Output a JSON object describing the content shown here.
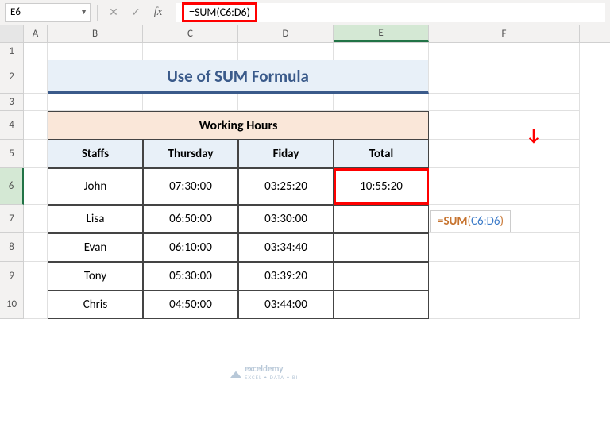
{
  "nameBox": "E6",
  "formula": "=SUM(C6:D6)",
  "columns": [
    "A",
    "B",
    "C",
    "D",
    "E",
    "F"
  ],
  "selectedCol": "E",
  "selectedRow": 6,
  "title": "Use of SUM Formula",
  "tableHeader": "Working Hours",
  "headers": {
    "staffs": "Staffs",
    "thursday": "Thursday",
    "friday": "Fiday",
    "total": "Total"
  },
  "rows": [
    {
      "staff": "John",
      "thu": "07:30:00",
      "fri": "03:25:20",
      "total": "10:55:20"
    },
    {
      "staff": "Lisa",
      "thu": "06:50:00",
      "fri": "03:30:00",
      "total": ""
    },
    {
      "staff": "Evan",
      "thu": "06:10:00",
      "fri": "03:34:40",
      "total": ""
    },
    {
      "staff": "Tony",
      "thu": "05:30:00",
      "fri": "03:39:20",
      "total": ""
    },
    {
      "staff": "Chris",
      "thu": "04:50:00",
      "fri": "03:44:00",
      "total": ""
    }
  ],
  "annotFormula": {
    "eq": "=",
    "fn": "SUM",
    "open": "(",
    "ref": "C6:D6",
    "close": ")"
  },
  "watermark": {
    "brand": "exceldemy",
    "tagline": "EXCEL • DATA • BI"
  },
  "chart_data": {
    "type": "table",
    "title": "Working Hours",
    "columns": [
      "Staffs",
      "Thursday",
      "Fiday",
      "Total"
    ],
    "rows": [
      [
        "John",
        "07:30:00",
        "03:25:20",
        "10:55:20"
      ],
      [
        "Lisa",
        "06:50:00",
        "03:30:00",
        ""
      ],
      [
        "Evan",
        "06:10:00",
        "03:34:40",
        ""
      ],
      [
        "Tony",
        "05:30:00",
        "03:39:20",
        ""
      ],
      [
        "Chris",
        "04:50:00",
        "03:44:00",
        ""
      ]
    ]
  }
}
